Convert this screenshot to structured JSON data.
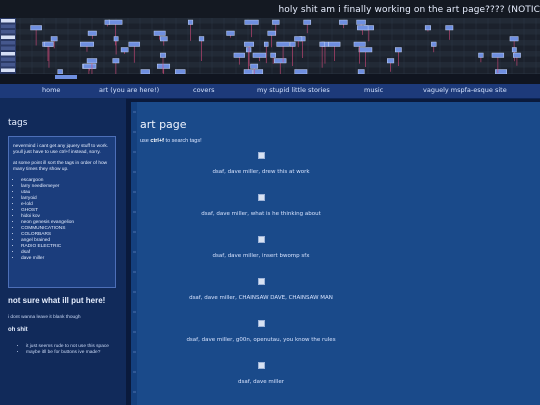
{
  "marquee": "holy shit am i finally working on the art page???? (NOTIC",
  "colors": {
    "header_bg": "#141922",
    "note": "#6f8fe0",
    "note_border": "#d8e4ff",
    "stem": "#d04a7a",
    "nav_bg": "#1d3a7a",
    "sidebar_bg": "#112a5a",
    "main_bg": "#1a4a8a"
  },
  "nav": [
    {
      "label": "home"
    },
    {
      "label": "art (you are here!)"
    },
    {
      "label": "covers"
    },
    {
      "label": "my stupid little stories"
    },
    {
      "label": "music"
    },
    {
      "label": "vaguely mspfa-esque site"
    }
  ],
  "sidebar": {
    "tags_heading": "tags",
    "tags_intro_1": "nevermind i cant get any jquery stuff to work. youll just have to use ctrl+f instead, sorry.",
    "tags_intro_2": "at some point ill sort the tags in order of how many times they show up.",
    "tags": [
      "escargoon",
      "larry needlemeyer",
      "utau",
      "larryoid",
      "e-lold",
      "GHOST",
      "hidoi kov",
      "neon genesis evangelion",
      "COMMUNICATIONS",
      "COLORBARS",
      "angel brained",
      "RADIO ELECTRIC",
      "dsaf",
      "dave miller"
    ],
    "heading2": "not sure what ill put here!",
    "text2": "i dont wanna leave it blank though",
    "heading3": "oh shit",
    "list3": [
      "it just seems rude to not use this space",
      "maybe itll be for buttons ive made?"
    ]
  },
  "main": {
    "title": "art page",
    "search_hint_pre": "use ",
    "search_hint_key": "ctrl+f",
    "search_hint_post": " to search tags!",
    "items": [
      {
        "caption": "dsaf, dave miller, drew this at work"
      },
      {
        "caption": "dsaf, dave miller, what is he thinking about"
      },
      {
        "caption": "dsaf, dave miller, insert bwomp sfx"
      },
      {
        "caption": "dsaf, dave miller, CHAINSAW DAVE, CHAINSAW MAN"
      },
      {
        "caption": "dsaf, dave miller, g00n, openutau, you know the rules"
      },
      {
        "caption": "dsaf, dave miller"
      }
    ]
  }
}
